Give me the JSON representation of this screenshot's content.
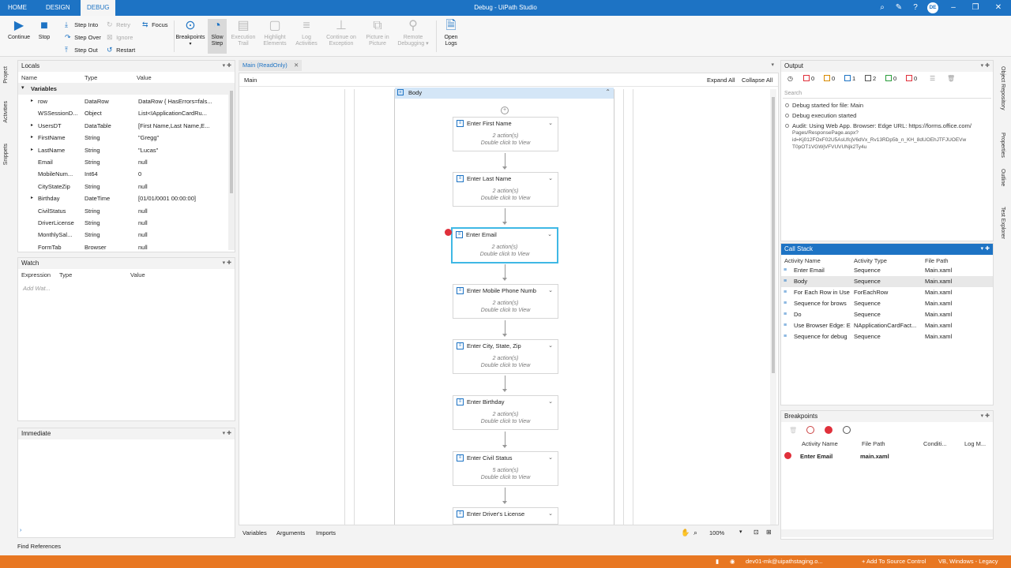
{
  "titlebar": {
    "tabs": [
      "HOME",
      "DESIGN",
      "DEBUG"
    ],
    "title": "Debug - UiPath Studio",
    "avatar": "DE"
  },
  "ribbon": {
    "continue": "Continue",
    "stop": "Stop",
    "step_into": "Step Into",
    "step_over": "Step Over",
    "step_out": "Step Out",
    "retry": "Retry",
    "ignore": "Ignore",
    "restart": "Restart",
    "focus": "Focus",
    "breakpoints": "Breakpoints",
    "slow_step_1": "Slow",
    "slow_step_2": "Step",
    "execution_trail_1": "Execution",
    "execution_trail_2": "Trail",
    "highlight_1": "Highlight",
    "highlight_2": "Elements",
    "log_1": "Log",
    "log_2": "Activities",
    "continue_exc_1": "Continue on",
    "continue_exc_2": "Exception",
    "pip_1": "Picture in",
    "pip_2": "Picture",
    "remote_1": "Remote",
    "remote_2": "Debugging",
    "open_logs_1": "Open",
    "open_logs_2": "Logs"
  },
  "left_tabs": [
    "Project",
    "Activities",
    "Snippets"
  ],
  "right_tabs": [
    "Object Repository",
    "Properties",
    "Outline",
    "Test Explorer"
  ],
  "locals": {
    "title": "Locals",
    "col_name": "Name",
    "col_type": "Type",
    "col_value": "Value",
    "group": "Variables",
    "rows": [
      {
        "name": "row",
        "type": "DataRow",
        "value": "DataRow { HasErrors=fals...",
        "expand": true
      },
      {
        "name": "WSSessionD...",
        "type": "Object",
        "value": "List<IApplicationCardRu...",
        "expand": false
      },
      {
        "name": "UsersDT",
        "type": "DataTable",
        "value": "[First Name,Last Name,E...",
        "expand": true
      },
      {
        "name": "FirstName",
        "type": "String",
        "value": "\"Gregg\"",
        "expand": true
      },
      {
        "name": "LastName",
        "type": "String",
        "value": "\"Lucas\"",
        "expand": true
      },
      {
        "name": "Email",
        "type": "String",
        "value": "null",
        "expand": false
      },
      {
        "name": "MobileNum...",
        "type": "Int64",
        "value": "0",
        "expand": false
      },
      {
        "name": "CityStateZip",
        "type": "String",
        "value": "null",
        "expand": false
      },
      {
        "name": "Birthday",
        "type": "DateTime",
        "value": "[01/01/0001 00:00:00]",
        "expand": true
      },
      {
        "name": "CivilStatus",
        "type": "String",
        "value": "null",
        "expand": false
      },
      {
        "name": "DriverLicense",
        "type": "String",
        "value": "null",
        "expand": false
      },
      {
        "name": "MonthlySal...",
        "type": "String",
        "value": "null",
        "expand": false
      },
      {
        "name": "FormTab",
        "type": "Browser",
        "value": "null",
        "expand": false
      }
    ]
  },
  "watch": {
    "title": "Watch",
    "col_expression": "Expression",
    "col_type": "Type",
    "col_value": "Value",
    "placeholder": "Add Wat..."
  },
  "immediate": {
    "title": "Immediate"
  },
  "find_references": "Find References",
  "designer": {
    "tab": "Main (ReadOnly)",
    "breadcrumb": "Main",
    "expand_all": "Expand All",
    "collapse_all": "Collapse All",
    "body_title": "Body",
    "activities": [
      {
        "title": "Enter First Name",
        "s1": "2 action(s)",
        "s2": "Double click to View"
      },
      {
        "title": "Enter Last Name",
        "s1": "2 action(s)",
        "s2": "Double click to View"
      },
      {
        "title": "Enter Email",
        "s1": "2 action(s)",
        "s2": "Double click to View"
      },
      {
        "title": "Enter Mobile Phone Numb",
        "s1": "2 action(s)",
        "s2": "Double click to View"
      },
      {
        "title": "Enter City, State, Zip",
        "s1": "2 action(s)",
        "s2": "Double click to View"
      },
      {
        "title": "Enter Birthday",
        "s1": "2 action(s)",
        "s2": "Double click to View"
      },
      {
        "title": "Enter Civil Status",
        "s1": "5 action(s)",
        "s2": "Double click to View"
      },
      {
        "title": "Enter Driver's License",
        "s1": "",
        "s2": ""
      }
    ],
    "bottom_tabs": [
      "Variables",
      "Arguments",
      "Imports"
    ],
    "zoom": "100%"
  },
  "output": {
    "title": "Output",
    "filters": [
      "0",
      "0",
      "1",
      "2",
      "0",
      "0"
    ],
    "search_placeholder": "Search",
    "lines": [
      "Debug started for file: Main",
      "Debug execution started",
      "Audit: Using Web App. Browser: Edge URL: https://forms.office.com/",
      "Pages/ResponsePage.aspx?",
      "id=Kj012FOxF02U5AsUfcjV6dVx_Rv13RDp5b_n_KH_8dUOEhJTFJUOEVw",
      "T0pOT1VGWjVFVUVUNjk2Ty4u"
    ]
  },
  "callstack": {
    "title": "Call Stack",
    "col_name": "Activity Name",
    "col_type": "Activity Type",
    "col_path": "File Path",
    "rows": [
      {
        "name": "Enter Email",
        "type": "Sequence",
        "path": "Main.xaml"
      },
      {
        "name": "Body",
        "type": "Sequence",
        "path": "Main.xaml"
      },
      {
        "name": "For Each Row in Use",
        "type": "ForEachRow",
        "path": "Main.xaml"
      },
      {
        "name": "Sequence for brows",
        "type": "Sequence",
        "path": "Main.xaml"
      },
      {
        "name": "Do",
        "type": "Sequence",
        "path": "Main.xaml"
      },
      {
        "name": "Use Browser Edge: E",
        "type": "NApplicationCardFact...",
        "path": "Main.xaml"
      },
      {
        "name": "Sequence for debug",
        "type": "Sequence",
        "path": "Main.xaml"
      }
    ]
  },
  "breakpoints": {
    "title": "Breakpoints",
    "col_name": "Activity Name",
    "col_path": "File Path",
    "col_cond": "Conditi...",
    "col_log": "Log M...",
    "rows": [
      {
        "name": "Enter Email",
        "path": "main.xaml"
      }
    ]
  },
  "statusbar": {
    "user": "dev01-mk@uipathstaging.o...",
    "source_control": "+ Add To Source Control",
    "env": "VB, Windows - Legacy"
  },
  "colors": {
    "accent": "#1d73c4",
    "status": "#e87722",
    "selected": "#3fb8e5",
    "breakpoint": "#e0303b"
  }
}
